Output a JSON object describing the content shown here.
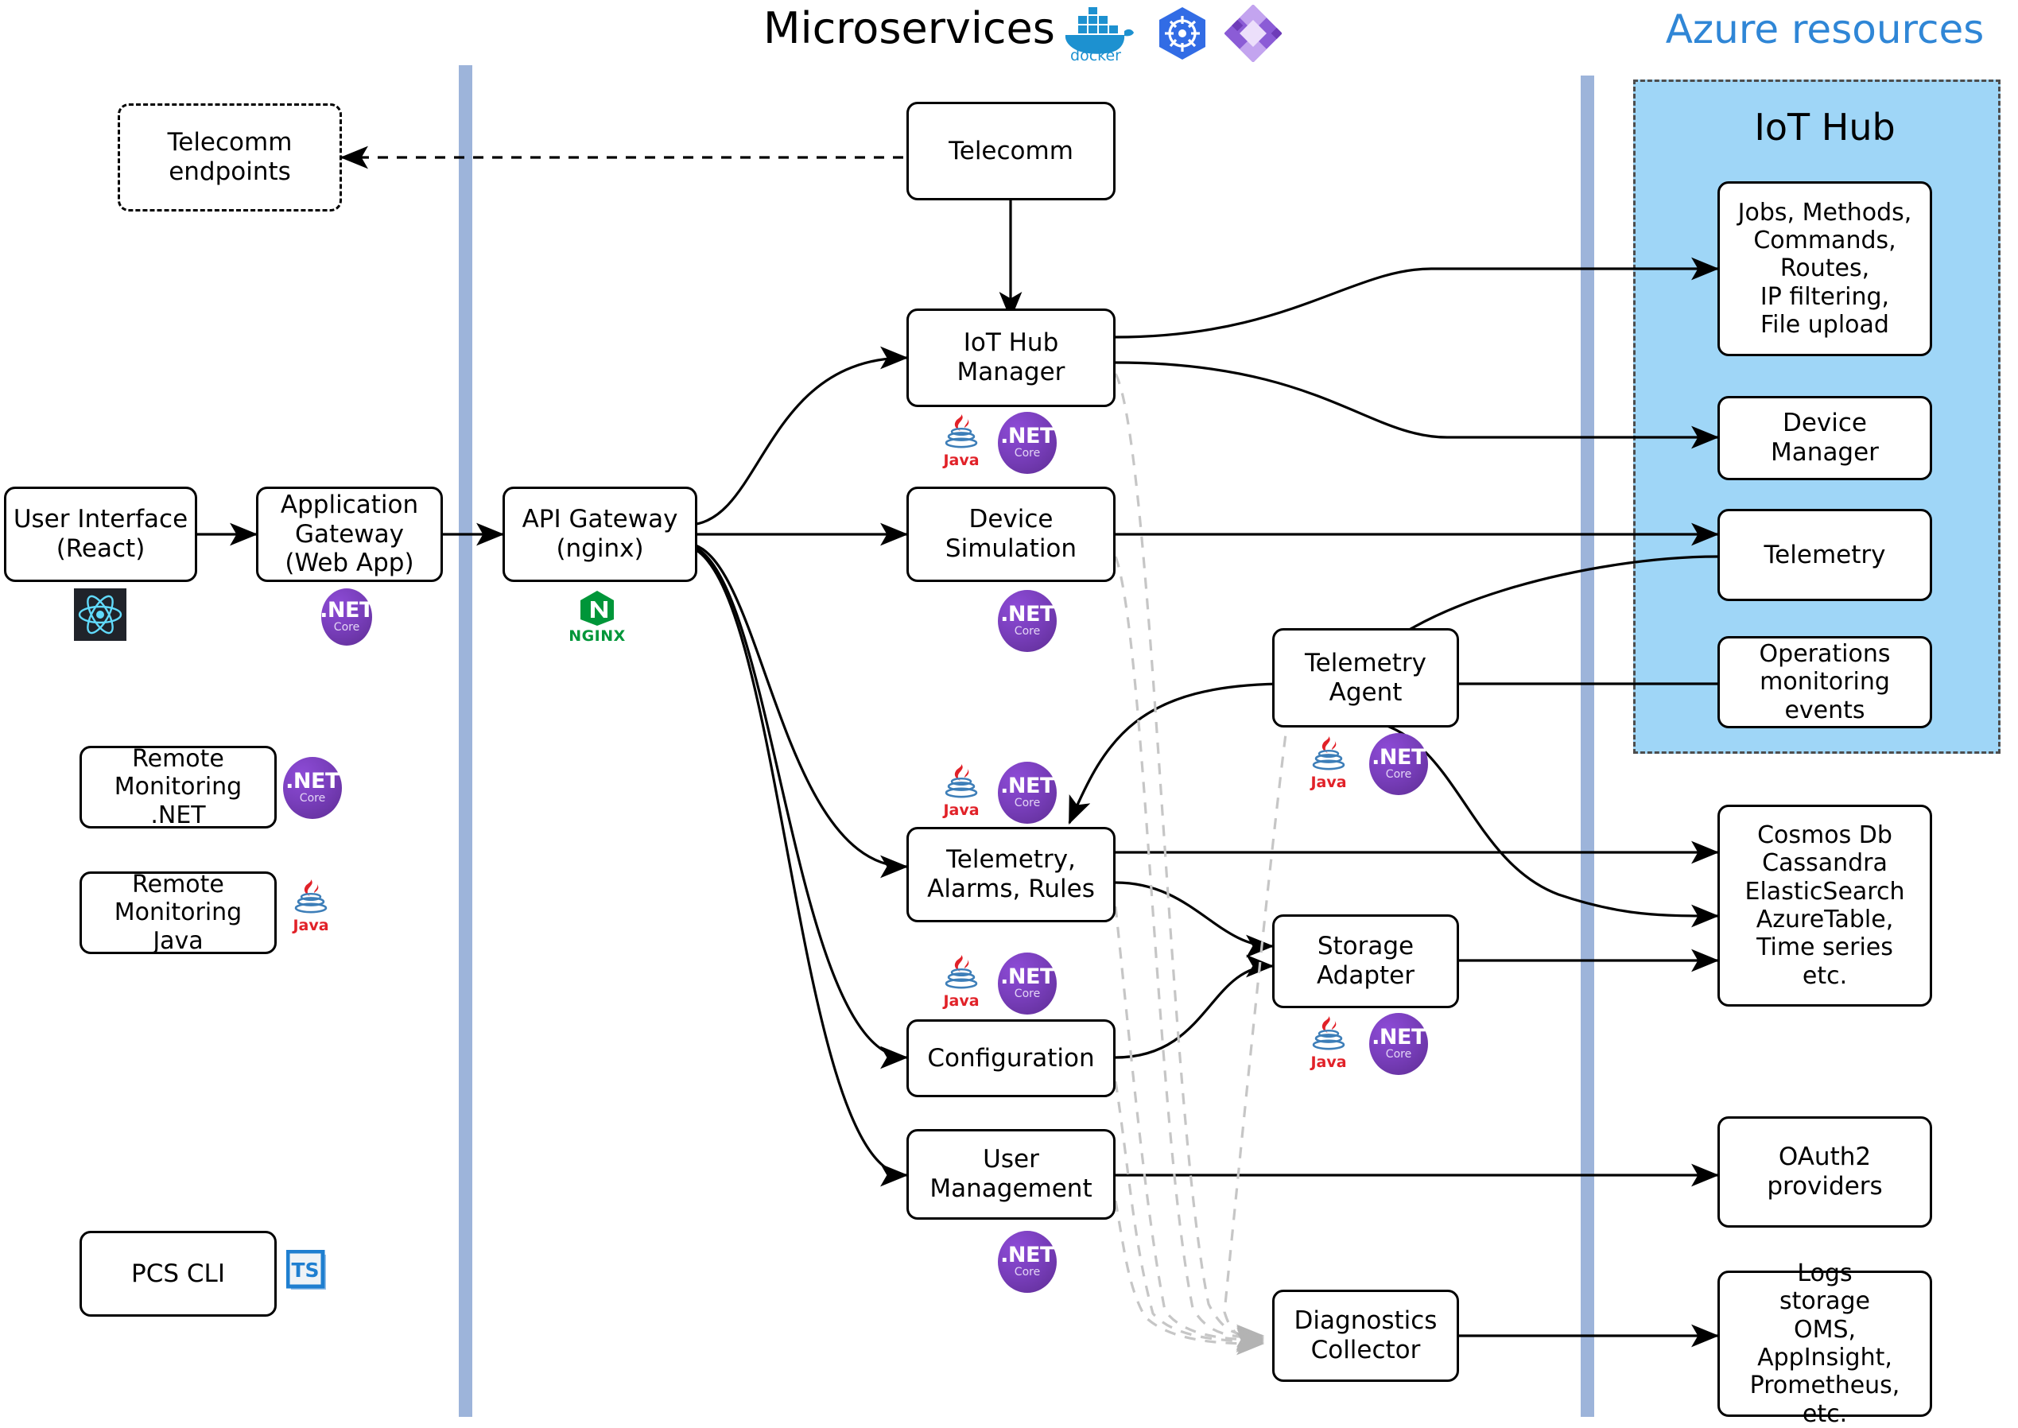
{
  "headings": {
    "microservices": "Microservices",
    "azure_resources": "Azure resources",
    "iot_hub": "IoT Hub"
  },
  "header_icons": [
    {
      "name": "docker-icon",
      "label": "docker"
    },
    {
      "name": "kubernetes-icon",
      "label": "kubernetes"
    },
    {
      "name": "helm-icon",
      "label": "helm"
    }
  ],
  "colors": {
    "azure_title": "#2f86d6",
    "azure_panel_fill": "#9fd6f7",
    "lane_divider": "#9db4da",
    "dotnet_badge": "#7a3fbd",
    "nginx_green": "#009639",
    "java_red": "#e12128",
    "typescript_blue": "#1f7fd0"
  },
  "clients": {
    "telecomm_endpoints": "Telecomm\nendpoints",
    "user_interface": "User Interface\n(React)",
    "application_gateway": "Application\nGateway\n(Web App)",
    "api_gateway": "API Gateway\n(nginx)",
    "remote_monitoring_net": "Remote\nMonitoring .NET",
    "remote_monitoring_java": "Remote\nMonitoring Java",
    "pcs_cli": "PCS CLI"
  },
  "microservices": [
    {
      "id": "telecomm",
      "label": "Telecomm",
      "badges": []
    },
    {
      "id": "iot-hub-manager",
      "label": "IoT Hub\nManager",
      "badges": [
        "java",
        "dotnet"
      ]
    },
    {
      "id": "device-simulation",
      "label": "Device\nSimulation",
      "badges": [
        "dotnet"
      ]
    },
    {
      "id": "telemetry-agent",
      "label": "Telemetry\nAgent",
      "badges": [
        "java",
        "dotnet"
      ]
    },
    {
      "id": "telemetry-alarms-rules",
      "label": "Telemetry,\nAlarms, Rules",
      "badges": [
        "java",
        "dotnet"
      ]
    },
    {
      "id": "storage-adapter",
      "label": "Storage\nAdapter",
      "badges": [
        "java",
        "dotnet"
      ]
    },
    {
      "id": "configuration",
      "label": "Configuration",
      "badges": [
        "java",
        "dotnet"
      ]
    },
    {
      "id": "user-management",
      "label": "User\nManagement",
      "badges": [
        "dotnet"
      ]
    },
    {
      "id": "diagnostics-collector",
      "label": "Diagnostics\nCollector",
      "badges": []
    }
  ],
  "azure": {
    "iot_hub_items": [
      {
        "id": "jobs-methods",
        "label": "Jobs, Methods,\nCommands,\nRoutes,\nIP filtering,\nFile upload"
      },
      {
        "id": "device-manager",
        "label": "Device Manager"
      },
      {
        "id": "telemetry",
        "label": "Telemetry"
      },
      {
        "id": "operations-monitoring-events",
        "label": "Operations\nmonitoring events"
      }
    ],
    "external_items": [
      {
        "id": "cosmos-db",
        "label": "Cosmos Db\nCassandra\nElasticSearch\nAzureTable,\nTime series\netc."
      },
      {
        "id": "oauth2-providers",
        "label": "OAuth2\nproviders"
      },
      {
        "id": "logs-storage",
        "label": "Logs\nstorage\nOMS, AppInsight,\nPrometheus, etc."
      }
    ]
  },
  "badge_labels": {
    "dotnet_top": ".NET",
    "dotnet_bottom": "Core",
    "java": "Java",
    "nginx": "NGINX",
    "typescript": "TS"
  }
}
